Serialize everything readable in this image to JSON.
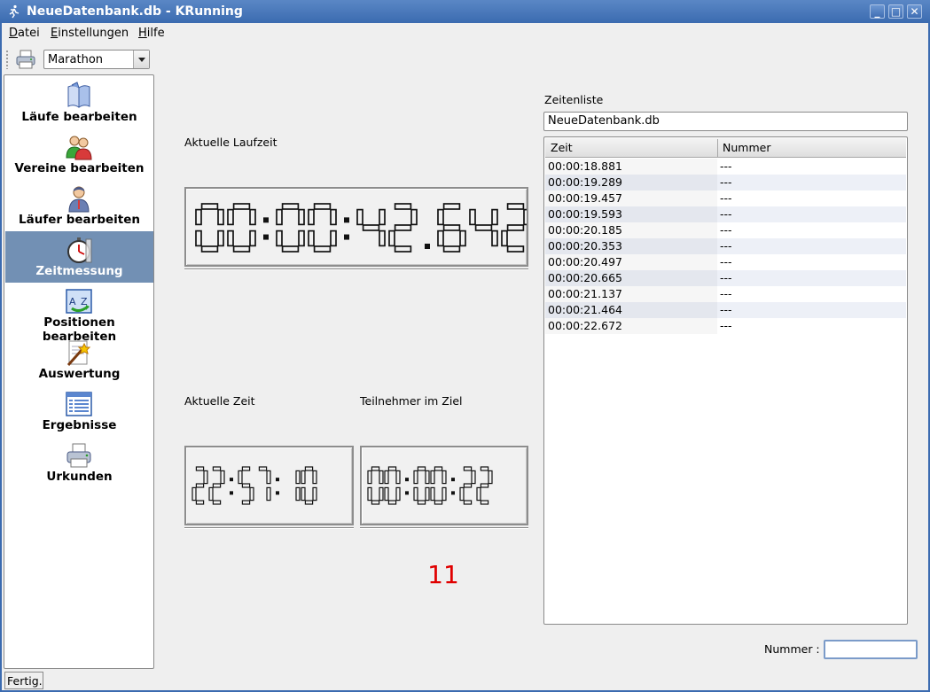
{
  "window": {
    "title": "NeueDatenbank.db - KRunning",
    "minimize": "_",
    "maximize": "□",
    "close": "✕"
  },
  "menu": {
    "items": [
      {
        "accel": "D",
        "rest": "atei"
      },
      {
        "accel": "E",
        "rest": "instellungen"
      },
      {
        "accel": "H",
        "rest": "ilfe"
      }
    ]
  },
  "toolbar": {
    "print_icon": "printer-icon",
    "run_select": "Marathon"
  },
  "sidebar": {
    "items": [
      {
        "label": "Läufe bearbeiten",
        "icon": "book-icon"
      },
      {
        "label": "Vereine bearbeiten",
        "icon": "group-icon"
      },
      {
        "label": "Läufer bearbeiten",
        "icon": "person-icon"
      },
      {
        "label": "Zeitmessung",
        "icon": "stopwatch-icon",
        "active": true
      },
      {
        "label": "Positionen bearbeiten",
        "icon": "positions-icon"
      },
      {
        "label": "Auswertung",
        "icon": "wand-icon"
      },
      {
        "label": "Ergebnisse",
        "icon": "list-icon"
      },
      {
        "label": "Urkunden",
        "icon": "printer-icon"
      }
    ]
  },
  "main": {
    "laufzeit_label": "Aktuelle Laufzeit",
    "laufzeit_value": "00:00:42.642",
    "zeit_label": "Aktuelle Zeit",
    "zeit_value": "22:57:10",
    "ziel_label": "Teilnehmer im Ziel",
    "ziel_value": "00:00:22",
    "finisher_count": "11"
  },
  "zeitenliste": {
    "label": "Zeitenliste",
    "database": "NeueDatenbank.db",
    "columns": [
      "Zeit",
      "Nummer"
    ],
    "rows": [
      [
        "00:00:18.881",
        "---"
      ],
      [
        "00:00:19.289",
        "---"
      ],
      [
        "00:00:19.457",
        "---"
      ],
      [
        "00:00:19.593",
        "---"
      ],
      [
        "00:00:20.185",
        "---"
      ],
      [
        "00:00:20.353",
        "---"
      ],
      [
        "00:00:20.497",
        "---"
      ],
      [
        "00:00:20.665",
        "---"
      ],
      [
        "00:00:21.137",
        "---"
      ],
      [
        "00:00:21.464",
        "---"
      ],
      [
        "00:00:22.672",
        "---"
      ]
    ]
  },
  "nummer": {
    "label": "Nummer :",
    "value": ""
  },
  "status": "Fertig.",
  "colors": {
    "accent": "#3b6bb0",
    "selection": "#7290b4",
    "counter": "#e00000"
  }
}
